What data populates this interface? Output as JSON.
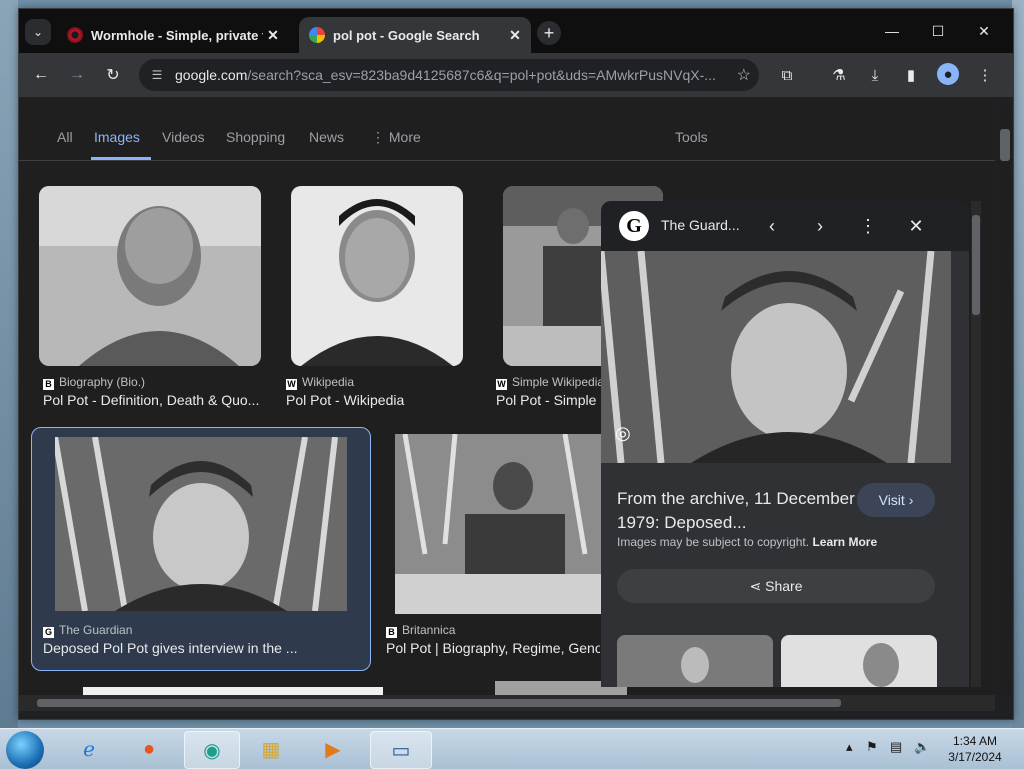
{
  "browser": {
    "tabs": [
      {
        "title": "Wormhole - Simple, private file",
        "active": false
      },
      {
        "title": "pol pot - Google Search",
        "active": true
      }
    ],
    "url_host": "google.com",
    "url_path": "/search?sca_esv=823ba9d4125687c6&q=pol+pot&uds=AMwkrPusNVqX-..."
  },
  "search": {
    "filters": [
      "All",
      "Images",
      "Videos",
      "Shopping",
      "News",
      "More",
      "Tools"
    ],
    "active_filter": "Images",
    "results": [
      {
        "source": "Biography (Bio.)",
        "source_icon": "B",
        "title": "Pol Pot - Definition, Death & Quo..."
      },
      {
        "source": "Wikipedia",
        "source_icon": "W",
        "title": "Pol Pot - Wikipedia"
      },
      {
        "source": "Simple Wikipedia",
        "source_icon": "W",
        "title": "Pol Pot - Simple"
      },
      {
        "source": "The Guardian",
        "source_icon": "G",
        "title": "Deposed Pol Pot gives interview in the ..."
      },
      {
        "source": "Britannica",
        "source_icon": "B",
        "title": "Pol Pot | Biography, Regime, Geno"
      }
    ]
  },
  "panel": {
    "source": "The Guard...",
    "logo_letter": "G",
    "title": "From the archive, 11 December 1979: Deposed...",
    "visit_label": "Visit",
    "copyright_text": "Images may be subject to copyright.",
    "learn_more": "Learn More",
    "share_label": "Share"
  },
  "taskbar": {
    "time": "1:34 AM",
    "date": "3/17/2024"
  },
  "icons": [
    "tab-search-icon",
    "wormhole-icon",
    "google-icon",
    "close-icon",
    "plus-icon",
    "minimize-icon",
    "maximize-icon",
    "back-icon",
    "forward-icon",
    "reload-icon",
    "site-info-icon",
    "star-icon",
    "extensions-icon",
    "labs-icon",
    "download-icon",
    "sidebar-icon",
    "profile-icon",
    "menu-icon",
    "lens-icon",
    "share-icon",
    "chevron-left-icon",
    "chevron-right-icon"
  ]
}
